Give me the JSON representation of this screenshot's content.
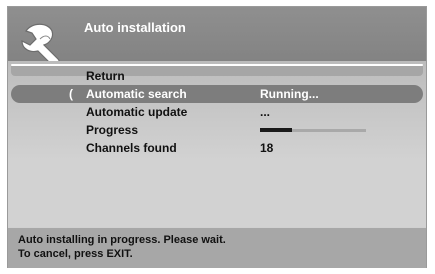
{
  "header": {
    "title": "Auto installation"
  },
  "menu": {
    "items": [
      {
        "label": "Return",
        "value": ""
      },
      {
        "label": "Automatic search",
        "value": "Running..."
      },
      {
        "label": "Automatic update",
        "value": "..."
      },
      {
        "label": "Progress",
        "value": ""
      },
      {
        "label": "Channels found",
        "value": "18"
      }
    ],
    "selected_index": 1,
    "cursor_symbol": "(",
    "progress_fraction": 0.3
  },
  "footer": {
    "line1": "Auto installing in progress. Please wait.",
    "line2": "To cancel, press EXIT."
  },
  "colors": {
    "header_bg": "#8f8f8f",
    "selected_bg": "#7d7d7d",
    "menu_bg": "#d0d0d0",
    "footer_bg": "#a7a7a7"
  },
  "icons": {
    "logo": "wrench-icon"
  }
}
